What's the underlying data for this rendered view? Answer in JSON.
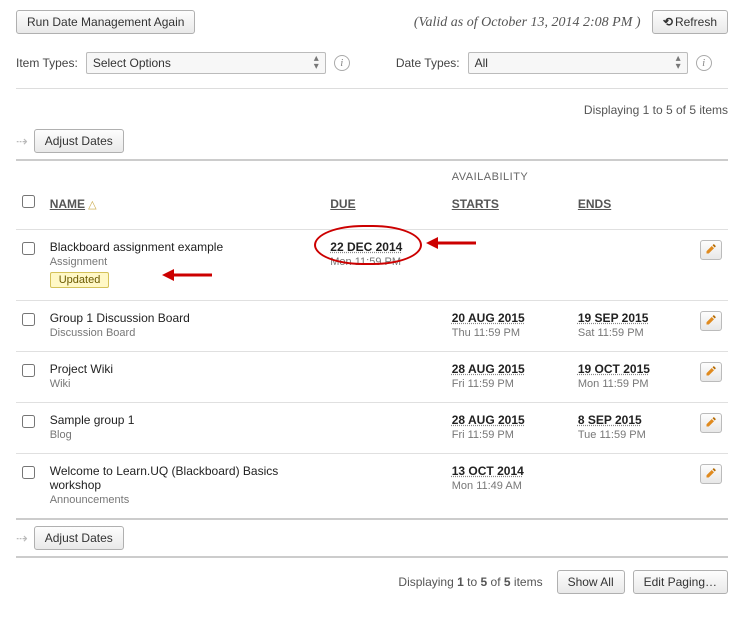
{
  "topbar": {
    "run_again": "Run Date Management Again",
    "valid_text": "(Valid as of October 13, 2014 2:08 PM )",
    "refresh": "Refresh"
  },
  "filters": {
    "item_types_label": "Item Types:",
    "item_types_value": "Select Options",
    "date_types_label": "Date Types:",
    "date_types_value": "All"
  },
  "count_top": "Displaying 1 to 5 of 5 items",
  "adjust_dates": "Adjust Dates",
  "headers": {
    "name": "NAME",
    "due": "DUE",
    "availability": "AVAILABILITY",
    "starts": "STARTS",
    "ends": "ENDS"
  },
  "updated_badge": "Updated",
  "rows": [
    {
      "name": "Blackboard assignment example",
      "type": "Assignment",
      "updated": true,
      "due_main": "22 DEC 2014",
      "due_sub": "Mon 11:59 PM",
      "start_main": "",
      "start_sub": "",
      "end_main": "",
      "end_sub": ""
    },
    {
      "name": "Group 1 Discussion Board",
      "type": "Discussion Board",
      "updated": false,
      "due_main": "",
      "due_sub": "",
      "start_main": "20 AUG 2015",
      "start_sub": "Thu 11:59 PM",
      "end_main": "19 SEP 2015",
      "end_sub": "Sat 11:59 PM"
    },
    {
      "name": "Project Wiki",
      "type": "Wiki",
      "updated": false,
      "due_main": "",
      "due_sub": "",
      "start_main": "28 AUG 2015",
      "start_sub": "Fri 11:59 PM",
      "end_main": "19 OCT 2015",
      "end_sub": "Mon 11:59 PM"
    },
    {
      "name": "Sample group 1",
      "type": "Blog",
      "updated": false,
      "due_main": "",
      "due_sub": "",
      "start_main": "28 AUG 2015",
      "start_sub": "Fri 11:59 PM",
      "end_main": "8 SEP 2015",
      "end_sub": "Tue 11:59 PM"
    },
    {
      "name": "Welcome to Learn.UQ (Blackboard) Basics workshop",
      "type": "Announcements",
      "updated": false,
      "due_main": "",
      "due_sub": "",
      "start_main": "13 OCT 2014",
      "start_sub": "Mon 11:49 AM",
      "end_main": "",
      "end_sub": ""
    }
  ],
  "footer": {
    "count_html_prefix": "Displaying ",
    "count_bold1": "1",
    "count_mid": " to ",
    "count_bold2": "5",
    "count_of": " of ",
    "count_bold3": "5",
    "count_suffix": " items",
    "show_all": "Show All",
    "edit_paging": "Edit Paging…"
  }
}
